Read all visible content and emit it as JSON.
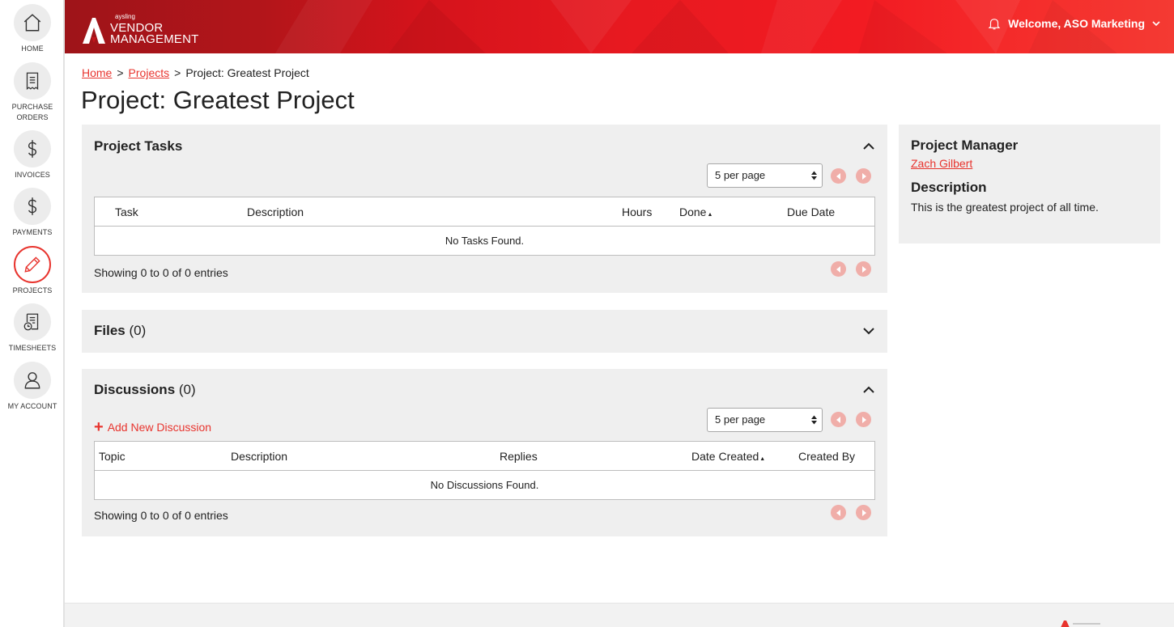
{
  "sidebar": {
    "items": [
      {
        "label": "HOME",
        "icon": "home-icon"
      },
      {
        "label": "PURCHASE ORDERS",
        "icon": "document-icon"
      },
      {
        "label": "INVOICES",
        "icon": "dollar-icon"
      },
      {
        "label": "PAYMENTS",
        "icon": "dollar-icon"
      },
      {
        "label": "PROJECTS",
        "icon": "pencil-icon",
        "active": true
      },
      {
        "label": "TIMESHEETS",
        "icon": "timesheet-icon"
      },
      {
        "label": "MY ACCOUNT",
        "icon": "user-icon"
      }
    ]
  },
  "header": {
    "logo_small": "aysling",
    "logo_line1": "VENDOR",
    "logo_line2": "MANAGEMENT",
    "welcome": "Welcome, ASO Marketing"
  },
  "breadcrumb": {
    "home": "Home",
    "separator": ">",
    "projects": "Projects",
    "current": "Project: Greatest Project"
  },
  "page_title": "Project: Greatest Project",
  "tasks": {
    "title": "Project Tasks",
    "per_page": "5 per page",
    "columns": [
      "Task",
      "Description",
      "Hours",
      "Done",
      "Due Date"
    ],
    "empty": "No Tasks Found.",
    "entries": "Showing 0 to 0 of 0 entries"
  },
  "files": {
    "title": "Files",
    "count": "(0)"
  },
  "discussions": {
    "title": "Discussions",
    "count": "(0)",
    "add_label": "Add New Discussion",
    "per_page": "5 per page",
    "columns": [
      "Topic",
      "Description",
      "Replies",
      "Date Created",
      "Created By"
    ],
    "empty": "No Discussions Found.",
    "entries": "Showing 0 to 0 of 0 entries"
  },
  "info": {
    "manager_heading": "Project Manager",
    "manager_name": "Zach Gilbert",
    "description_heading": "Description",
    "description": "This is the greatest project of all time."
  },
  "colors": {
    "accent": "#e8342e",
    "header_dark": "#9e1419",
    "header_bright": "#f21b22",
    "panel_bg": "#efefef",
    "pager": "#f0aea9"
  }
}
